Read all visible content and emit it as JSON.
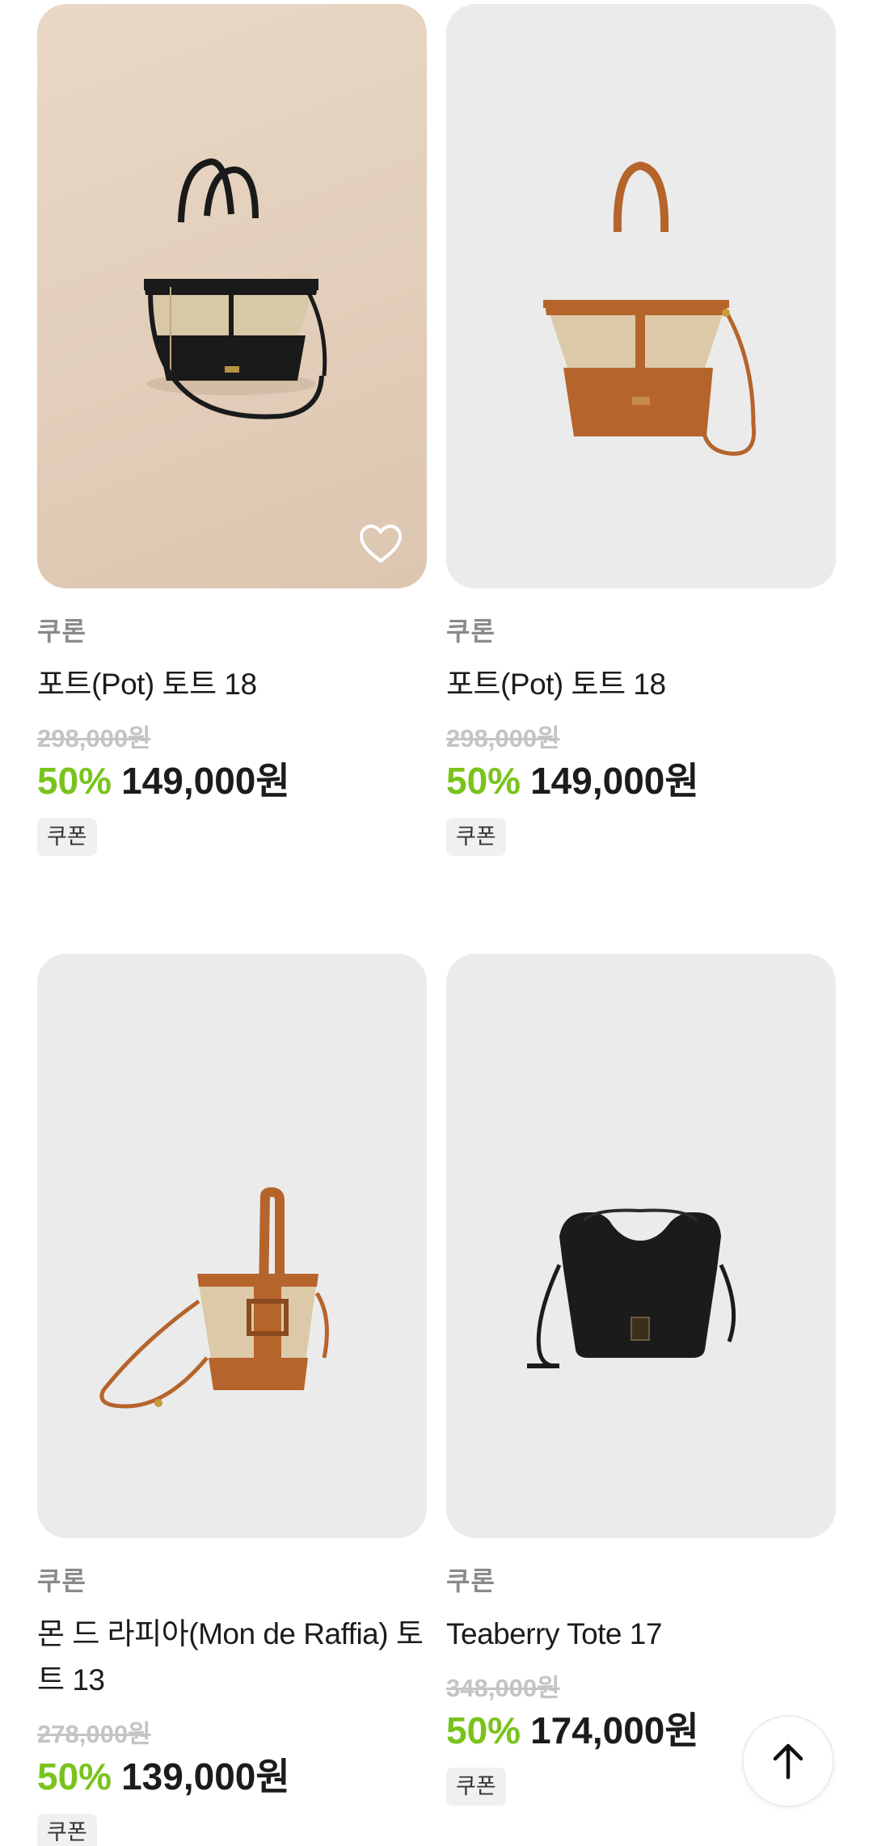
{
  "products": [
    {
      "brand": "쿠론",
      "title": "포트(Pot) 토트 18",
      "original_price": "298,000원",
      "discount": "50%",
      "sale_price": "149,000원",
      "badge": "쿠폰",
      "bag_color": "black",
      "wishlist_icon": "heart-outline-icon"
    },
    {
      "brand": "쿠론",
      "title": "포트(Pot) 토트 18",
      "original_price": "298,000원",
      "discount": "50%",
      "sale_price": "149,000원",
      "badge": "쿠폰",
      "bag_color": "tan"
    },
    {
      "brand": "쿠론",
      "title": "몬 드 라피아(Mon de Raffia) 토트 13",
      "original_price": "278,000원",
      "discount": "50%",
      "sale_price": "139,000원",
      "badge": "쿠폰",
      "bag_color": "tan"
    },
    {
      "brand": "쿠론",
      "title": "Teaberry Tote 17",
      "original_price": "348,000원",
      "discount": "50%",
      "sale_price": "174,000원",
      "badge": "쿠폰",
      "bag_color": "black"
    }
  ],
  "scroll_top_icon": "arrow-up-icon",
  "colors": {
    "discount": "#7ac31c",
    "price": "#1c1c1c",
    "original_price": "#c4c4c4",
    "brand": "#8a8a8a",
    "image_bg": "#ebebeb"
  }
}
